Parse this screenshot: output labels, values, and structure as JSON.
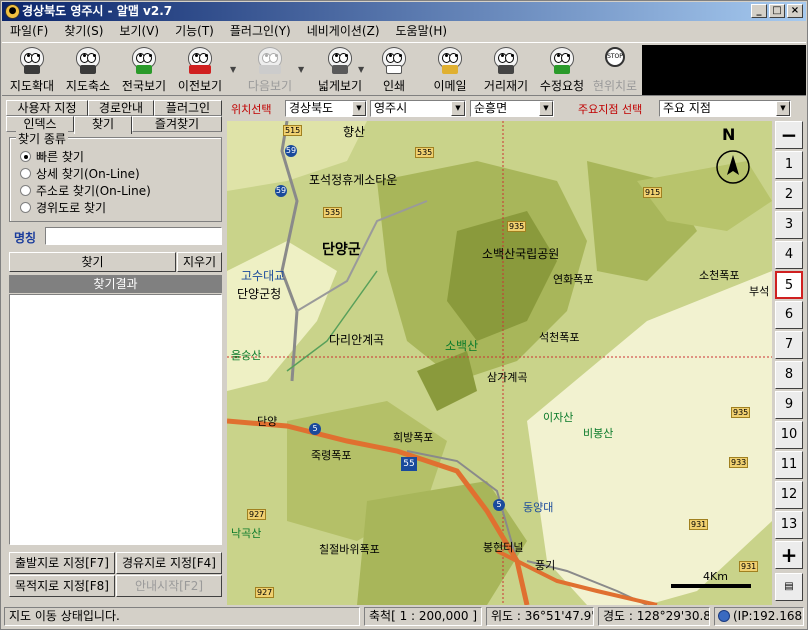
{
  "window": {
    "title": "경상북도 영주시 - 알맵 v2.7",
    "buttons": [
      "_",
      "□",
      "×"
    ]
  },
  "menu": [
    "파일(F)",
    "찾기(S)",
    "보기(V)",
    "기능(T)",
    "플러그인(Y)",
    "네비게이션(Z)",
    "도움말(H)"
  ],
  "toolbar": [
    {
      "label": "지도확대",
      "icon": "zoom-in-face-icon",
      "disabled": false
    },
    {
      "label": "지도축소",
      "icon": "zoom-out-face-icon",
      "disabled": false
    },
    {
      "label": "전국보기",
      "icon": "nationwide-face-icon",
      "disabled": false
    },
    {
      "label": "이전보기",
      "icon": "previous-view-face-icon",
      "disabled": false
    },
    {
      "label": "다음보기",
      "icon": "next-view-face-icon",
      "disabled": true
    },
    {
      "label": "넓게보기",
      "icon": "wide-view-face-icon",
      "disabled": false
    },
    {
      "label": "인쇄",
      "icon": "print-face-icon",
      "disabled": false
    },
    {
      "label": "이메일",
      "icon": "email-face-icon",
      "disabled": false
    },
    {
      "label": "거리재기",
      "icon": "measure-distance-face-icon",
      "disabled": false
    },
    {
      "label": "수정요청",
      "icon": "edit-request-face-icon",
      "disabled": false
    },
    {
      "label": "현위치로",
      "icon": "current-location-face-icon",
      "disabled": true
    }
  ],
  "left": {
    "tabs_row1": [
      "사용자 지정",
      "경로안내",
      "플러그인"
    ],
    "tabs_row2": [
      "인덱스",
      "찾기",
      "즐겨찾기"
    ],
    "active_tab": "찾기",
    "search_type": {
      "legend": "찾기 종류",
      "options": [
        "빠른 찾기",
        "상세 찾기(On-Line)",
        "주소로 찾기(On-Line)",
        "경위도로 찾기"
      ],
      "selected": "빠른 찾기"
    },
    "name_label": "명칭",
    "name_value": "",
    "find_button": "찾기",
    "clear_button": "지우기",
    "results_header": "찾기결과",
    "route_buttons": [
      "출발지로 지정[F7]",
      "경유지로 지정[F4]",
      "목적지로 지정[F8]",
      "안내시작[F2]"
    ]
  },
  "mapbar": {
    "left_label": "위치선택",
    "province": "경상북도",
    "city": "영주시",
    "town": "순흥면",
    "poi_label": "주요지점 선택",
    "poi_value": "주요 지점"
  },
  "zoom": {
    "minus": "−",
    "plus": "+",
    "levels": [
      "1",
      "2",
      "3",
      "4",
      "5",
      "6",
      "7",
      "8",
      "9",
      "10",
      "11",
      "12",
      "13"
    ],
    "selected": "5"
  },
  "map": {
    "compass": "N",
    "scale_label": "4Km",
    "labels": [
      "향산",
      "포석정휴게소타운",
      "단양군",
      "소백산국립공원",
      "연화폭포",
      "소천폭포",
      "부석",
      "고수대교",
      "단양군청",
      "다리안계곡",
      "소백산",
      "석천폭포",
      "삼가계곡",
      "을숭산",
      "단양",
      "이자산",
      "비봉산",
      "희방폭포",
      "죽령폭포",
      "동양대",
      "낙곡산",
      "칠절바위폭포",
      "봉현터널",
      "풍기"
    ],
    "route_numbers": [
      "59",
      "59",
      "5",
      "55",
      "5"
    ],
    "road_numbers": [
      "515",
      "535",
      "535",
      "935",
      "935",
      "933",
      "927",
      "931",
      "931",
      "915",
      "927"
    ]
  },
  "status": {
    "message": "지도 이동 상태입니다.",
    "scale": "축척[ 1 : 200,000 ]",
    "lat": "위도 : 36°51'47.9\"",
    "lon": "경도 : 128°29'30.89\"",
    "ip": "(IP:192.168"
  }
}
